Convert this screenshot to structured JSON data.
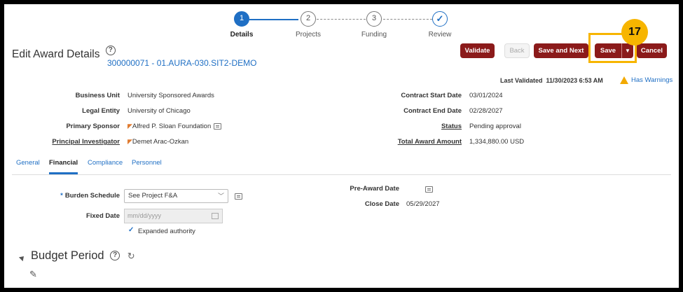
{
  "train": {
    "steps": [
      {
        "number": "1",
        "label": "Details"
      },
      {
        "number": "2",
        "label": "Projects"
      },
      {
        "number": "3",
        "label": "Funding"
      },
      {
        "number": "✓",
        "label": "Review"
      }
    ]
  },
  "header": {
    "title": "Edit Award Details",
    "award_number": "300000071 - 01.AURA-030.SIT2-DEMO",
    "help_glyph": "?"
  },
  "toolbar": {
    "validate_label": "Validate",
    "back_label": "Back",
    "save_next_label": "Save and Next",
    "save_label": "Save",
    "save_menu_glyph": "▼",
    "cancel_label": "Cancel"
  },
  "callout": {
    "step_number": "17",
    "highlight_color": "#f7b500"
  },
  "validation": {
    "last_validated_label": "Last Validated",
    "last_validated_value": "11/30/2023 6:53 AM",
    "warnings_label": "Has Warnings"
  },
  "details": {
    "left": [
      {
        "label": "Business Unit",
        "value": "University Sponsored Awards"
      },
      {
        "label": "Legal Entity",
        "value": "University of Chicago"
      },
      {
        "label": "Primary Sponsor",
        "value": "Alfred P. Sloan Foundation"
      },
      {
        "label": "Principal Investigator",
        "value": "Demet Arac-Ozkan"
      }
    ],
    "right": [
      {
        "label": "Contract Start Date",
        "value": "03/01/2024"
      },
      {
        "label": "Contract End Date",
        "value": "02/28/2027"
      },
      {
        "label": "Status",
        "value": "Pending approval"
      },
      {
        "label": "Total Award Amount",
        "value": "1,334,880.00  USD"
      }
    ]
  },
  "tabs": [
    {
      "label": "General"
    },
    {
      "label": "Financial"
    },
    {
      "label": "Compliance"
    },
    {
      "label": "Personnel"
    }
  ],
  "financial": {
    "required_marker": "*",
    "burden_schedule_label": "Burden Schedule",
    "burden_schedule_value": "See Project F&A",
    "fixed_date_label": "Fixed Date",
    "fixed_date_placeholder": "mm/dd/yyyy",
    "expanded_authority_label": "Expanded authority",
    "pre_award_date_label": "Pre-Award Date",
    "close_date_label": "Close Date",
    "close_date_value": "05/29/2027"
  },
  "budget_period": {
    "title": "Budget Period"
  },
  "colors": {
    "accent": "#1f6fc4",
    "brand_button": "#8b1a1a"
  }
}
